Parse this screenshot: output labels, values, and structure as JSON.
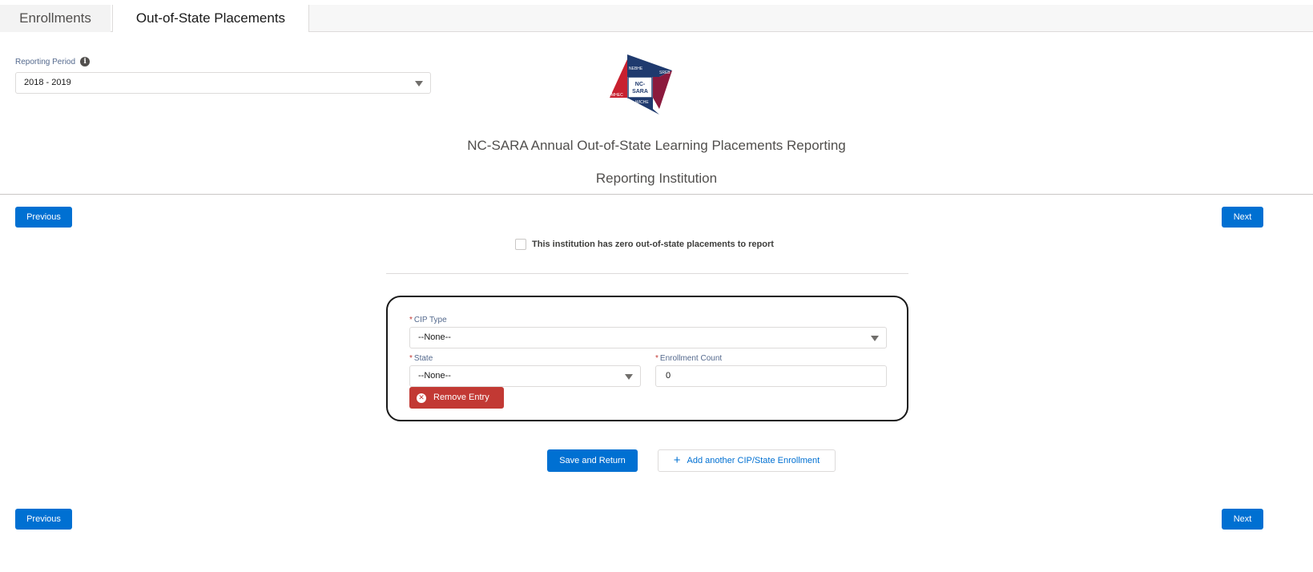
{
  "tabs": [
    {
      "label": "Enrollments",
      "active": false
    },
    {
      "label": "Out-of-State Placements",
      "active": true
    }
  ],
  "reporting_period": {
    "label": "Reporting Period",
    "value": "2018 - 2019"
  },
  "logo": {
    "regions": [
      "NEBHE",
      "SREB",
      "MHEC",
      "WICHE"
    ],
    "center_line1": "NC-",
    "center_line2": "SARA",
    "colors": {
      "navy": "#1f3a6e",
      "red": "#c8202f",
      "maroon": "#8b1a3d"
    }
  },
  "header": {
    "title": "NC-SARA Annual Out-of-State Learning Placements Reporting",
    "subtitle": "Reporting Institution"
  },
  "nav": {
    "previous_label": "Previous",
    "next_label": "Next"
  },
  "zero_placements": {
    "label": "This institution has zero out-of-state placements to report",
    "checked": false
  },
  "entry": {
    "required_marker": "*",
    "cip_type_label": "CIP Type",
    "cip_type_value": "--None--",
    "state_label": "State",
    "state_value": "--None--",
    "enrollment_count_label": "Enrollment Count",
    "enrollment_count_value": "0",
    "remove_label": "Remove Entry"
  },
  "actions": {
    "save_label": "Save and Return",
    "add_label": "Add another CIP/State Enrollment"
  },
  "colors": {
    "brand_blue": "#0070d2",
    "destructive_red": "#c23934"
  }
}
